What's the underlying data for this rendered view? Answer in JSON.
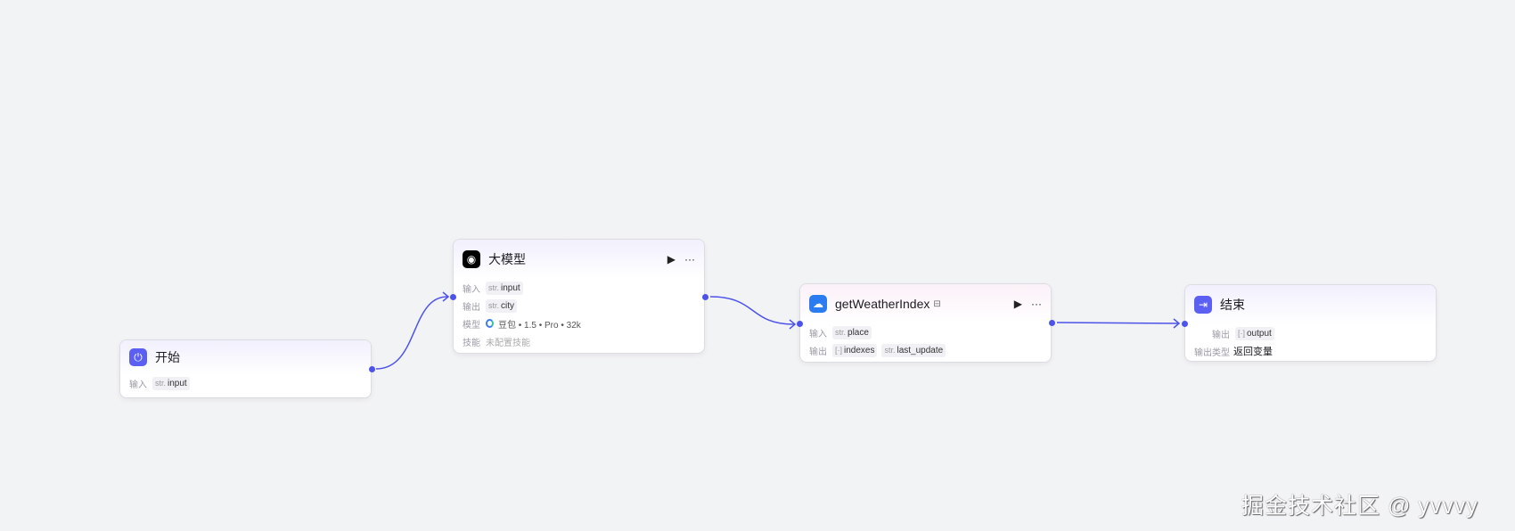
{
  "nodes": {
    "start": {
      "title": "开始",
      "input_label": "输入",
      "input": {
        "type": "str.",
        "name": "input"
      }
    },
    "llm": {
      "title": "大模型",
      "input_label": "输入",
      "input": {
        "type": "str.",
        "name": "input"
      },
      "output_label": "输出",
      "output": {
        "type": "str.",
        "name": "city"
      },
      "model_label": "模型",
      "model": "豆包 • 1.5 • Pro • 32k",
      "skill_label": "技能",
      "skill": "未配置技能",
      "run": "▶",
      "more": "···"
    },
    "weather": {
      "title": "getWeatherIndex",
      "input_label": "输入",
      "input": {
        "type": "str.",
        "name": "place"
      },
      "output_label": "输出",
      "outputs": [
        {
          "type": "[·]",
          "name": "indexes"
        },
        {
          "type": "str.",
          "name": "last_update"
        }
      ],
      "run": "▶",
      "more": "···"
    },
    "end": {
      "title": "结束",
      "output_label": "输出",
      "output": {
        "type": "[·]",
        "name": "output"
      },
      "output_type_label": "输出类型",
      "output_type": "返回变量"
    }
  },
  "watermark": "掘金技术社区 @ yvvvy",
  "colors": {
    "accent": "#4d53e8",
    "canvas": "#f2f3f5"
  }
}
